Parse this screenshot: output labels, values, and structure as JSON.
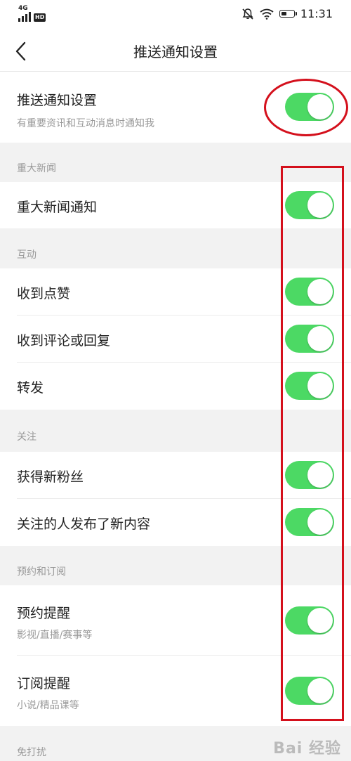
{
  "status_bar": {
    "network": "4G",
    "hd": "HD",
    "time": "11:31"
  },
  "header": {
    "title": "推送通知设置",
    "back_icon": "chevron-left-icon"
  },
  "master": {
    "label": "推送通知设置",
    "description": "有重要资讯和互动消息时通知我",
    "enabled": true
  },
  "sections": {
    "major_news": "重大新闻",
    "interaction": "互动",
    "follow": "关注",
    "booking": "预约和订阅",
    "dnd": "免打扰"
  },
  "items": {
    "major_news_notify": {
      "label": "重大新闻通知",
      "enabled": true
    },
    "likes": {
      "label": "收到点赞",
      "enabled": true
    },
    "comments": {
      "label": "收到评论或回复",
      "enabled": true
    },
    "reposts": {
      "label": "转发",
      "enabled": true
    },
    "new_fans": {
      "label": "获得新粉丝",
      "enabled": true
    },
    "followed_posts": {
      "label": "关注的人发布了新内容",
      "enabled": true
    },
    "booking_reminder": {
      "label": "预约提醒",
      "description": "影视/直播/赛事等",
      "enabled": true
    },
    "subscription_reminder": {
      "label": "订阅提醒",
      "description": "小说/精品课等",
      "enabled": true
    }
  },
  "colors": {
    "toggle_on": "#4cd964",
    "annotation": "#d4101c",
    "page_background": "#f2f2f2"
  },
  "watermark": "Bai 经验"
}
